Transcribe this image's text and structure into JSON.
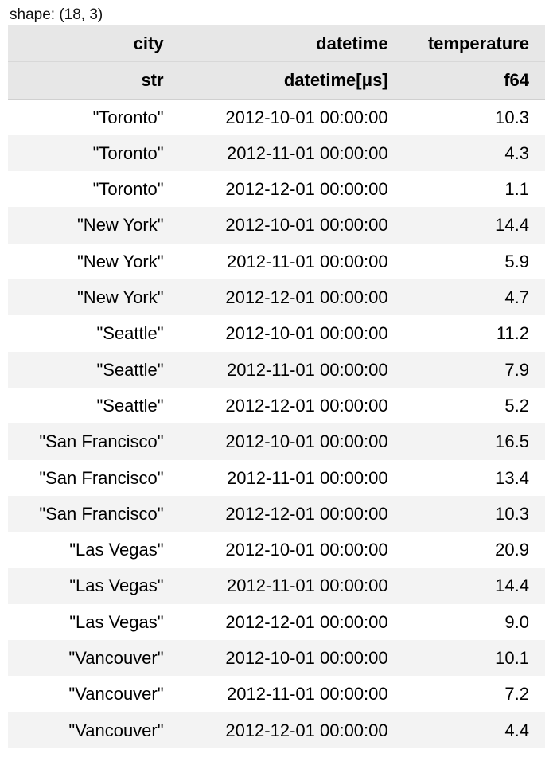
{
  "shape_label": "shape: (18, 3)",
  "columns": [
    {
      "name": "city",
      "dtype": "str"
    },
    {
      "name": "datetime",
      "dtype": "datetime[μs]"
    },
    {
      "name": "temperature",
      "dtype": "f64"
    }
  ],
  "rows": [
    {
      "city": "\"Toronto\"",
      "datetime": "2012-10-01 00:00:00",
      "temperature": "10.3"
    },
    {
      "city": "\"Toronto\"",
      "datetime": "2012-11-01 00:00:00",
      "temperature": "4.3"
    },
    {
      "city": "\"Toronto\"",
      "datetime": "2012-12-01 00:00:00",
      "temperature": "1.1"
    },
    {
      "city": "\"New York\"",
      "datetime": "2012-10-01 00:00:00",
      "temperature": "14.4"
    },
    {
      "city": "\"New York\"",
      "datetime": "2012-11-01 00:00:00",
      "temperature": "5.9"
    },
    {
      "city": "\"New York\"",
      "datetime": "2012-12-01 00:00:00",
      "temperature": "4.7"
    },
    {
      "city": "\"Seattle\"",
      "datetime": "2012-10-01 00:00:00",
      "temperature": "11.2"
    },
    {
      "city": "\"Seattle\"",
      "datetime": "2012-11-01 00:00:00",
      "temperature": "7.9"
    },
    {
      "city": "\"Seattle\"",
      "datetime": "2012-12-01 00:00:00",
      "temperature": "5.2"
    },
    {
      "city": "\"San Francisco\"",
      "datetime": "2012-10-01 00:00:00",
      "temperature": "16.5"
    },
    {
      "city": "\"San Francisco\"",
      "datetime": "2012-11-01 00:00:00",
      "temperature": "13.4"
    },
    {
      "city": "\"San Francisco\"",
      "datetime": "2012-12-01 00:00:00",
      "temperature": "10.3"
    },
    {
      "city": "\"Las Vegas\"",
      "datetime": "2012-10-01 00:00:00",
      "temperature": "20.9"
    },
    {
      "city": "\"Las Vegas\"",
      "datetime": "2012-11-01 00:00:00",
      "temperature": "14.4"
    },
    {
      "city": "\"Las Vegas\"",
      "datetime": "2012-12-01 00:00:00",
      "temperature": "9.0"
    },
    {
      "city": "\"Vancouver\"",
      "datetime": "2012-10-01 00:00:00",
      "temperature": "10.1"
    },
    {
      "city": "\"Vancouver\"",
      "datetime": "2012-11-01 00:00:00",
      "temperature": "7.2"
    },
    {
      "city": "\"Vancouver\"",
      "datetime": "2012-12-01 00:00:00",
      "temperature": "4.4"
    }
  ]
}
